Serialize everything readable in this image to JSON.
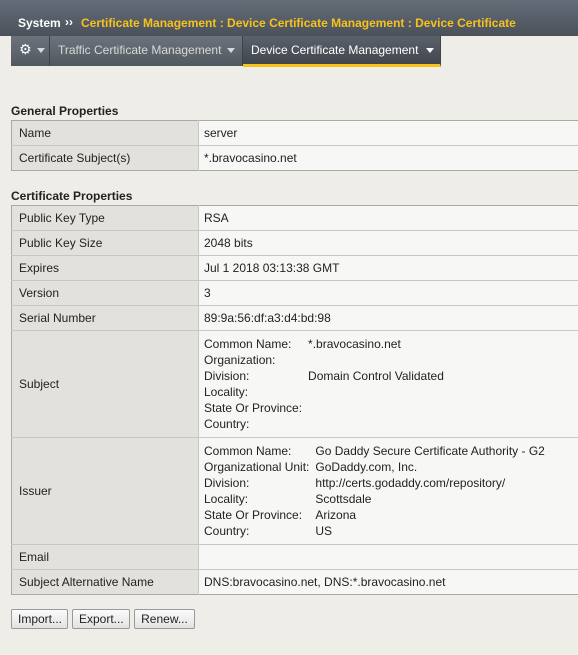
{
  "breadcrumb": {
    "root": "System",
    "separator": "››",
    "path": "Certificate Management : Device Certificate Management : Device Certificate"
  },
  "tabs": {
    "gear_icon": "gear-icon",
    "items": [
      {
        "label": "Traffic Certificate Management",
        "active": false
      },
      {
        "label": "Device Certificate Management",
        "active": true
      }
    ]
  },
  "general": {
    "title": "General Properties",
    "rows": [
      {
        "label": "Name",
        "value": "server"
      },
      {
        "label": "Certificate Subject(s)",
        "value": "*.bravocasino.net"
      }
    ]
  },
  "certificate": {
    "title": "Certificate Properties",
    "rows": [
      {
        "label": "Public Key Type",
        "value": "RSA"
      },
      {
        "label": "Public Key Size",
        "value": "2048 bits"
      },
      {
        "label": "Expires",
        "value": "Jul 1 2018 03:13:38 GMT"
      },
      {
        "label": "Version",
        "value": "3"
      },
      {
        "label": "Serial Number",
        "value": "89:9a:56:df:a3:d4:bd:98"
      }
    ],
    "subject": {
      "label": "Subject",
      "fields": [
        {
          "k": "Common Name:",
          "v": "*.bravocasino.net"
        },
        {
          "k": "Organization:",
          "v": ""
        },
        {
          "k": "Division:",
          "v": "Domain Control Validated"
        },
        {
          "k": "Locality:",
          "v": ""
        },
        {
          "k": "State Or Province:",
          "v": ""
        },
        {
          "k": "Country:",
          "v": ""
        }
      ]
    },
    "issuer": {
      "label": "Issuer",
      "fields": [
        {
          "k": "Common Name:",
          "v": "Go Daddy Secure Certificate Authority - G2"
        },
        {
          "k": "Organizational Unit:",
          "v": "GoDaddy.com, Inc."
        },
        {
          "k": "Division:",
          "v": "http://certs.godaddy.com/repository/"
        },
        {
          "k": "Locality:",
          "v": "Scottsdale"
        },
        {
          "k": "State Or Province:",
          "v": "Arizona"
        },
        {
          "k": "Country:",
          "v": "US"
        }
      ]
    },
    "email": {
      "label": "Email",
      "value": ""
    },
    "san": {
      "label": "Subject Alternative Name",
      "value": "DNS:bravocasino.net, DNS:*.bravocasino.net"
    }
  },
  "buttons": {
    "import": "Import...",
    "export": "Export...",
    "renew": "Renew..."
  },
  "colors": {
    "accent": "#f7c21c",
    "header_bg": "#4a515b",
    "page_bg": "#efede8"
  }
}
